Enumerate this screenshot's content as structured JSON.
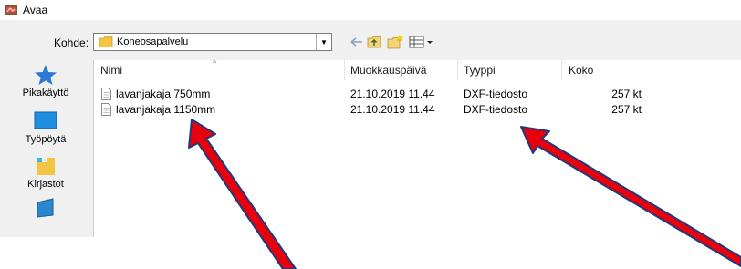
{
  "window": {
    "title": "Avaa"
  },
  "location": {
    "label": "Kohde:",
    "value": "Koneosapalvelu"
  },
  "places": [
    {
      "label": "Pikakäyttö",
      "icon": "star-icon"
    },
    {
      "label": "Työpöytä",
      "icon": "desktop-icon"
    },
    {
      "label": "Kirjastot",
      "icon": "libraries-icon"
    },
    {
      "label": "",
      "icon": "computer-icon"
    }
  ],
  "columns": {
    "name": "Nimi",
    "date": "Muokkauspäivä",
    "type": "Tyyppi",
    "size": "Koko"
  },
  "files": [
    {
      "name": "lavanjakaja 750mm",
      "date": "21.10.2019 11.44",
      "type": "DXF-tiedosto",
      "size": "257 kt"
    },
    {
      "name": "lavanjakaja 1150mm",
      "date": "21.10.2019 11.44",
      "type": "DXF-tiedosto",
      "size": "257 kt"
    }
  ],
  "colors": {
    "arrow_fill": "#e8000d",
    "arrow_outline": "#1f3a7a",
    "folder": "#f4c542"
  }
}
